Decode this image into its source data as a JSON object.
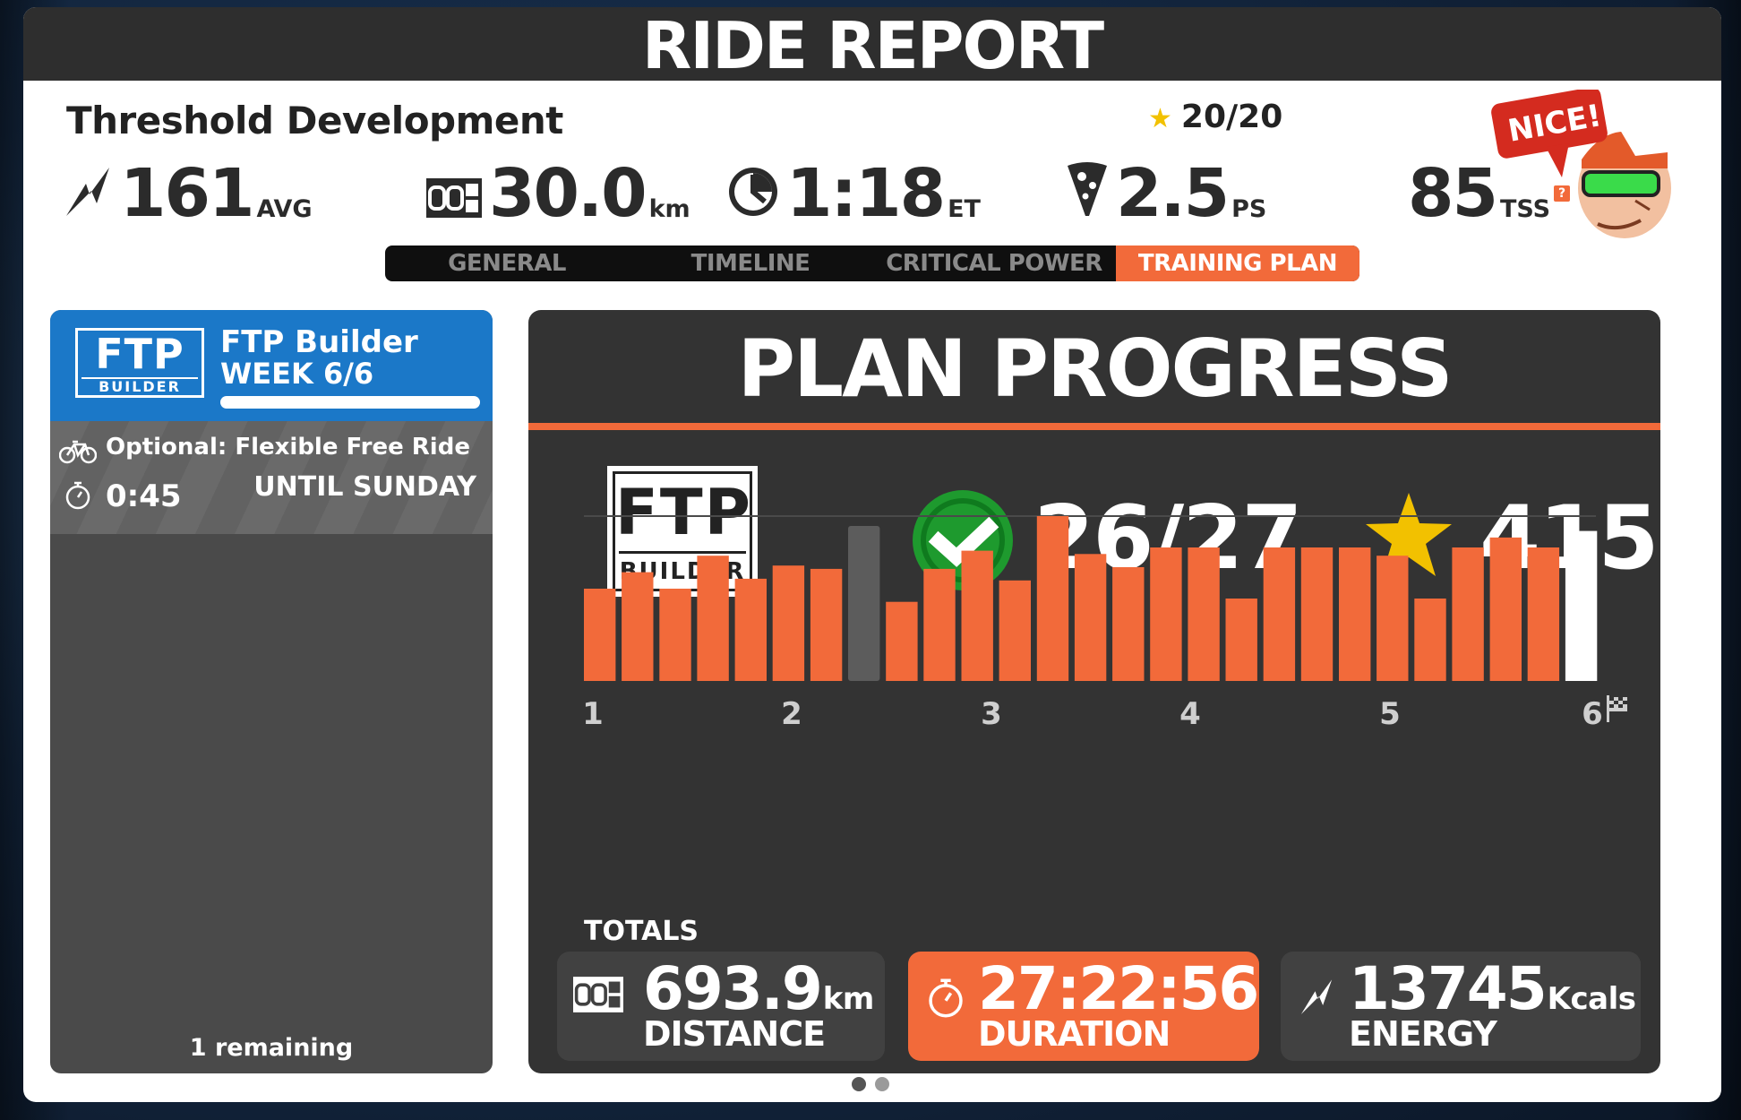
{
  "header": {
    "title": "RIDE REPORT"
  },
  "ride": {
    "workout_name": "Threshold Development",
    "stars": "20/20",
    "power": {
      "value": "161",
      "unit": "AVG"
    },
    "distance": {
      "value": "30.0",
      "unit": "km"
    },
    "time": {
      "value": "1:18",
      "unit": "ET"
    },
    "pizza": {
      "value": "2.5",
      "unit": "PS"
    },
    "tss": {
      "value": "85",
      "unit": "TSS",
      "help": "?"
    }
  },
  "mascot": {
    "bubble": "NICE!"
  },
  "tabs": [
    {
      "label": "GENERAL",
      "active": false
    },
    {
      "label": "TIMELINE",
      "active": false
    },
    {
      "label": "CRITICAL POWER",
      "active": false
    },
    {
      "label": "TRAINING PLAN",
      "active": true
    }
  ],
  "plan_card": {
    "badge_big": "FTP",
    "badge_small": "BUILDER",
    "name": "FTP Builder",
    "week": "WEEK 6/6",
    "progress_fraction": 1.0,
    "workout_name": "Optional: Flexible Free Ride",
    "workout_time": "0:45",
    "until": "UNTIL SUNDAY",
    "remaining": "1 remaining"
  },
  "plan_progress": {
    "title": "PLAN PROGRESS",
    "logo_big": "FTP",
    "logo_small": "BUILDER",
    "completed": "26/27",
    "stars": "415",
    "totals_label": "TOTALS",
    "totals": {
      "distance": {
        "value": "693.9",
        "unit": "km",
        "label": "DISTANCE"
      },
      "duration": {
        "value": "27:22:56",
        "label": "DURATION"
      },
      "energy": {
        "value": "13745",
        "unit": "Kcals",
        "label": "ENERGY"
      }
    }
  },
  "chart_data": {
    "type": "bar",
    "x_tick_labels": [
      "1",
      "2",
      "3",
      "4",
      "5",
      "6"
    ],
    "values": [
      56,
      66,
      56,
      76,
      62,
      70,
      68,
      94,
      48,
      68,
      79,
      61,
      100,
      77,
      69,
      81,
      81,
      50,
      81,
      81,
      81,
      76,
      50,
      81,
      87,
      81,
      91
    ],
    "bar_status": [
      "done",
      "done",
      "done",
      "done",
      "done",
      "done",
      "done",
      "skipped",
      "done",
      "done",
      "done",
      "done",
      "done",
      "done",
      "done",
      "done",
      "done",
      "done",
      "done",
      "done",
      "done",
      "done",
      "done",
      "done",
      "done",
      "done",
      "current"
    ],
    "colors": {
      "done": "#f26a3a",
      "skipped": "#5c5c5c",
      "current": "#ffffff"
    }
  },
  "pagination": {
    "count": 2,
    "active": 0
  },
  "colors": {
    "accent": "#f26a3a",
    "plan_blue": "#1b78c8",
    "success": "#1e9a2e",
    "star": "#f2c100"
  }
}
